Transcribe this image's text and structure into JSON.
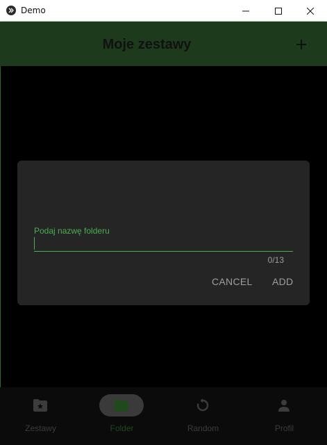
{
  "window": {
    "title": "Demo"
  },
  "header": {
    "title": "Moje zestawy"
  },
  "dialog": {
    "field_label": "Podaj nazwę folderu",
    "field_value": "",
    "counter": "0/13",
    "cancel_label": "CANCEL",
    "add_label": "ADD"
  },
  "nav": {
    "items": [
      {
        "label": "Zestawy",
        "icon": "folder-star-icon",
        "active": false
      },
      {
        "label": "Folder",
        "icon": "folder-icon",
        "active": true
      },
      {
        "label": "Random",
        "icon": "refresh-icon",
        "active": false
      },
      {
        "label": "Profil",
        "icon": "person-icon",
        "active": false
      }
    ]
  },
  "colors": {
    "accent": "#4caf50",
    "topbar": "#1e3a1c",
    "dialog_bg": "#252525",
    "background": "#000000"
  }
}
